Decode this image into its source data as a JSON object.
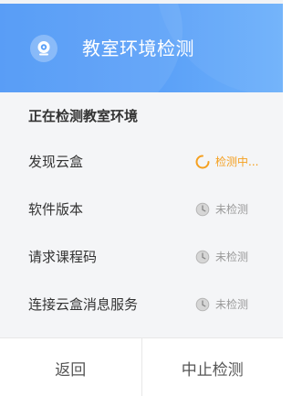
{
  "header": {
    "title": "教室环境检测",
    "icon": "projector-icon"
  },
  "section": {
    "title": "正在检测教室环境"
  },
  "checks": [
    {
      "label": "发现云盒",
      "status": "检测中...",
      "state": "checking",
      "icon": "loading-spinner-icon"
    },
    {
      "label": "软件版本",
      "status": "未检测",
      "state": "pending",
      "icon": "pending-clock-icon"
    },
    {
      "label": "请求课程码",
      "status": "未检测",
      "state": "pending",
      "icon": "pending-clock-icon"
    },
    {
      "label": "连接云盒消息服务",
      "status": "未检测",
      "state": "pending",
      "icon": "pending-clock-icon"
    }
  ],
  "footer": {
    "back_label": "返回",
    "stop_label": "中止检测"
  },
  "colors": {
    "header_blue": "#4b95f6",
    "checking_orange": "#f5a020",
    "pending_gray": "#999999"
  }
}
